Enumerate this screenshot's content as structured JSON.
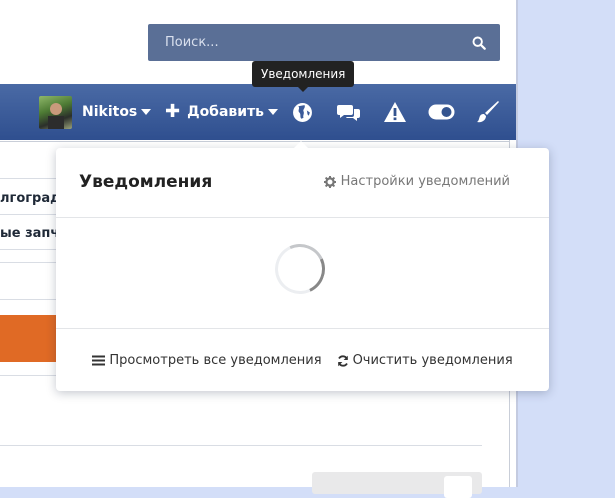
{
  "search": {
    "placeholder": "Поиск..."
  },
  "navbar": {
    "user_name": "Nikitos",
    "add_label": "Добавить",
    "icons": [
      "user-avatar",
      "globe-icon",
      "chat-icon",
      "alert-icon",
      "toggle-icon",
      "brush-icon"
    ]
  },
  "tooltip": {
    "text": "Уведомления"
  },
  "notifications": {
    "title": "Уведомления",
    "settings_label": "Настройки уведомлений",
    "view_all_label": "Просмотреть все уведомления",
    "clear_label": "Очистить уведомления"
  },
  "background": {
    "fragments": [
      "лгоград",
      "ые запча"
    ]
  },
  "colors": {
    "navbar_top": "#4a6aa5",
    "navbar_bottom": "#2f4f8f",
    "search_bg": "#5a6f96",
    "orange_block": "#e06a25",
    "backdrop": "#d3def8"
  }
}
